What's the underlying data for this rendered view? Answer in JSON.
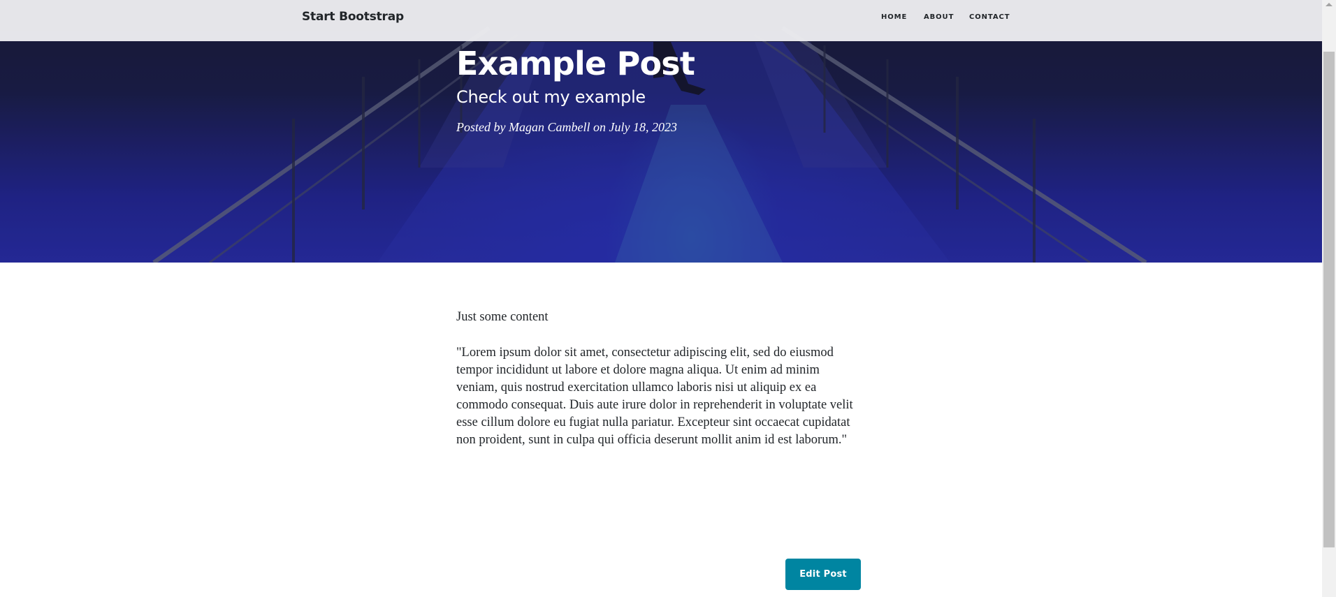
{
  "navbar": {
    "brand": "Start Bootstrap",
    "links": [
      {
        "label": "HOME"
      },
      {
        "label": "ABOUT"
      },
      {
        "label": "CONTACT"
      }
    ]
  },
  "post": {
    "title": "Example Post",
    "subtitle": "Check out my example",
    "meta": {
      "prefix": "Posted by",
      "author": "Magan Cambell",
      "date_prefix": "on",
      "date": "July 18, 2023"
    },
    "body": [
      "Just some content",
      "\"Lorem ipsum dolor sit amet, consectetur adipiscing elit, sed do eiusmod tempor incididunt ut labore et dolore magna aliqua. Ut enim ad minim veniam, quis nostrud exercitation ullamco laboris nisi ut aliquip ex ea commodo consequat. Duis aute irure dolor in reprehenderit in voluptate velit esse cillum dolore eu fugiat nulla pariatur. Excepteur sint occaecat cupidatat non proident, sunt in culpa qui officia deserunt mollit anim id est laborum.\""
    ]
  },
  "actions": {
    "edit_label": "Edit Post"
  },
  "colors": {
    "accent": "#0085a1",
    "navbar_bg": "#ececef",
    "text": "#212529"
  }
}
